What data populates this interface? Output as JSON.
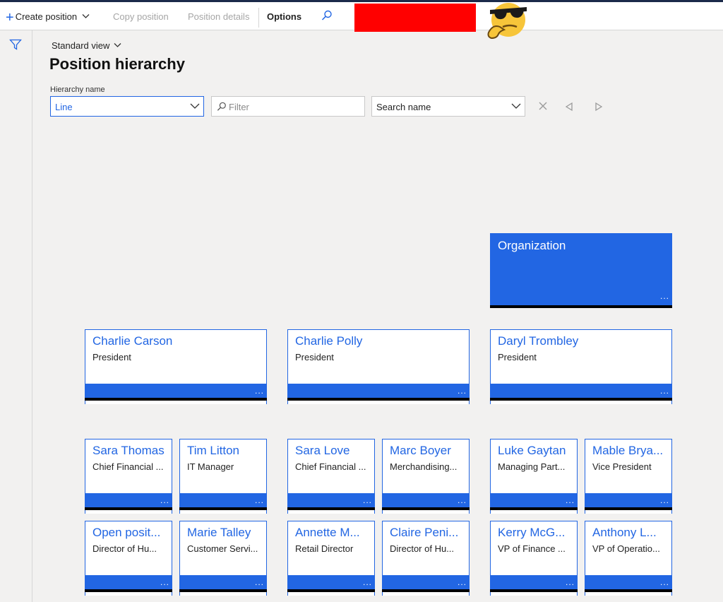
{
  "toolbar": {
    "create_label": "Create position",
    "copy_label": "Copy position",
    "details_label": "Position details",
    "options_label": "Options"
  },
  "header": {
    "view_label": "Standard view",
    "page_title": "Position hierarchy",
    "hierarchy_name_label": "Hierarchy name",
    "hierarchy_value": "Line",
    "filter_placeholder": "Filter",
    "search_select_value": "Search name"
  },
  "org": {
    "name": "Organization"
  },
  "top_level": [
    {
      "name": "Charlie Carson",
      "title": "President"
    },
    {
      "name": "Charlie Polly",
      "title": "President"
    },
    {
      "name": "Daryl Trombley",
      "title": "President"
    }
  ],
  "row1": [
    {
      "name": "Sara Thomas",
      "title": "Chief Financial ..."
    },
    {
      "name": "Tim Litton",
      "title": "IT Manager"
    },
    {
      "name": "Sara Love",
      "title": "Chief Financial ..."
    },
    {
      "name": "Marc Boyer",
      "title": "Merchandising..."
    },
    {
      "name": "Luke Gaytan",
      "title": "Managing Part..."
    },
    {
      "name": "Mable Brya...",
      "title": "Vice President"
    }
  ],
  "row2": [
    {
      "name": "Open posit...",
      "title": "Director of Hu..."
    },
    {
      "name": "Marie Talley",
      "title": "Customer Servi..."
    },
    {
      "name": "Annette M...",
      "title": "Retail Director"
    },
    {
      "name": "Claire Peni...",
      "title": "Director of Hu..."
    },
    {
      "name": "Kerry McG...",
      "title": "VP of Finance ..."
    },
    {
      "name": "Anthony L...",
      "title": "VP of Operatio..."
    }
  ],
  "card_more": "...",
  "colors": {
    "accent": "#2266e3",
    "toolbar_border": "#1b2a4a",
    "redbox": "#ff0000"
  }
}
